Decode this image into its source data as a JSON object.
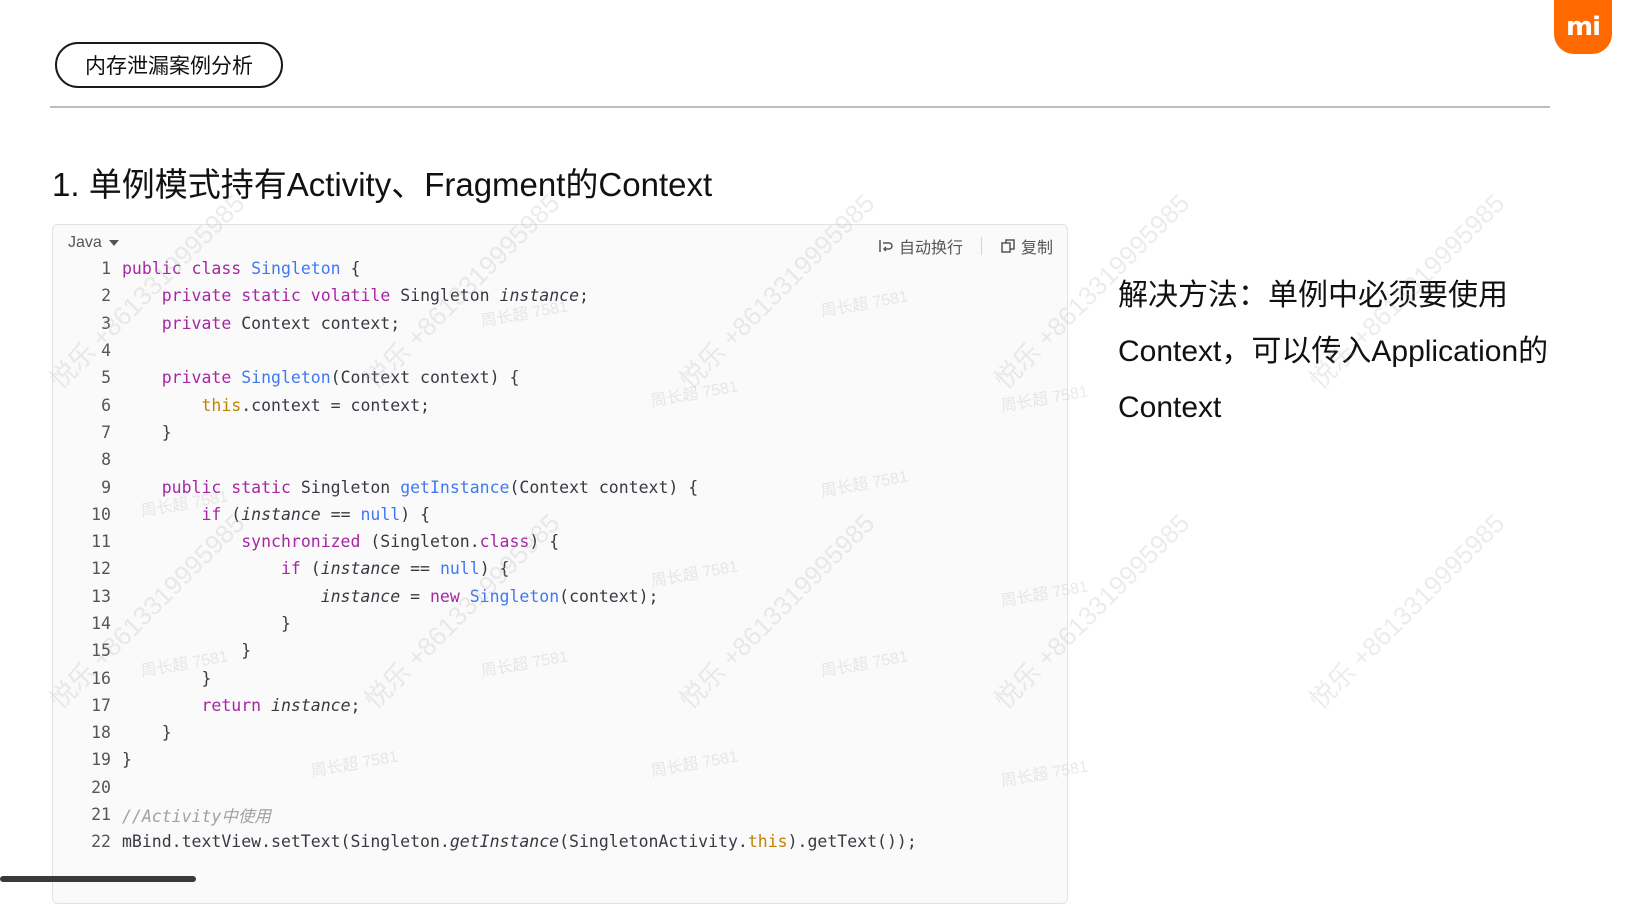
{
  "slide": {
    "tag_label": "内存泄漏案例分析",
    "logo_text": "mi",
    "heading": "1. 单例模式持有Activity、Fragment的Context"
  },
  "code_block": {
    "language": "Java",
    "wrap_label": "自动换行",
    "copy_label": "复制",
    "lines": [
      {
        "n": "1",
        "html": "<span class=\"k\">public</span> <span class=\"k\">class</span> <span class=\"f\">Singleton</span> {"
      },
      {
        "n": "2",
        "html": "    <span class=\"k\">private</span> <span class=\"k\">static</span> <span class=\"k\">volatile</span> Singleton <span class=\"i\">instance</span>;"
      },
      {
        "n": "3",
        "html": "    <span class=\"k\">private</span> Context context;"
      },
      {
        "n": "4",
        "html": ""
      },
      {
        "n": "5",
        "html": "    <span class=\"k\">private</span> <span class=\"f\">Singleton</span>(Context context) {"
      },
      {
        "n": "6",
        "html": "        <span class=\"o\">this</span>.context = context;"
      },
      {
        "n": "7",
        "html": "    }"
      },
      {
        "n": "8",
        "html": ""
      },
      {
        "n": "9",
        "html": "    <span class=\"k\">public</span> <span class=\"k\">static</span> Singleton <span class=\"f\">getInstance</span>(Context context) {"
      },
      {
        "n": "10",
        "html": "        <span class=\"k\">if</span> (<span class=\"i\">instance</span> == <span class=\"f\">null</span>) {"
      },
      {
        "n": "11",
        "html": "            <span class=\"k\">synchronized</span> (Singleton.<span class=\"k\">class</span>) {"
      },
      {
        "n": "12",
        "html": "                <span class=\"k\">if</span> (<span class=\"i\">instance</span> == <span class=\"f\">null</span>) {"
      },
      {
        "n": "13",
        "html": "                    <span class=\"i\">instance</span> = <span class=\"k\">new</span> <span class=\"f\">Singleton</span>(context);"
      },
      {
        "n": "14",
        "html": "                }"
      },
      {
        "n": "15",
        "html": "            }"
      },
      {
        "n": "16",
        "html": "        }"
      },
      {
        "n": "17",
        "html": "        <span class=\"k\">return</span> <span class=\"i\">instance</span>;"
      },
      {
        "n": "18",
        "html": "    }"
      },
      {
        "n": "19",
        "html": "}"
      },
      {
        "n": "20",
        "html": ""
      },
      {
        "n": "21",
        "html": "<span class=\"c\">//Activity中使用</span>"
      },
      {
        "n": "22",
        "html": "mBind.textView.setText(Singleton.<span class=\"i\">getInstance</span>(SingletonActivity.<span class=\"o\">this</span>).getText());"
      }
    ]
  },
  "solution_text": "解决方法：单例中必须要使用Context，可以传入Application的Context",
  "watermark": {
    "main": "悦乐 +8613319995985",
    "small": "周长超 7581"
  }
}
